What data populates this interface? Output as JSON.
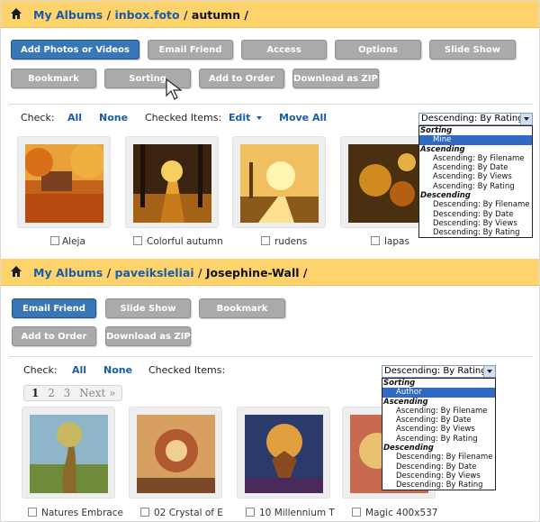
{
  "album1": {
    "breadcrumb": {
      "link1": "My Albums",
      "sep1": " / ",
      "link2": "inbox.foto",
      "sep2": " / ",
      "current": "autumn",
      "sep3": " /"
    },
    "buttons": [
      "Add Photos or Videos",
      "Email Friend",
      "Access",
      "Options",
      "Slide Show",
      "Bookmark",
      "Sorting",
      "Add to Order",
      "Download as ZIP"
    ],
    "check_label": "Check:",
    "all": "All",
    "none": "None",
    "checked_items": "Checked Items:",
    "edit": "Edit",
    "move_all": "Move All",
    "select_value": "Descending: By Rating",
    "dropdown": {
      "group_sorting": "Sorting",
      "mine": "Mine",
      "group_asc": "Ascending",
      "asc": [
        "Ascending: By Filename",
        "Ascending: By Date",
        "Ascending: By Views",
        "Ascending: By Rating"
      ],
      "group_desc": "Descending",
      "desc": [
        "Descending: By Filename",
        "Descending: By Date",
        "Descending: By Views",
        "Descending: By Rating"
      ]
    },
    "photos": [
      "Aleja",
      "Colorful autumn",
      "rudens",
      "lapas"
    ]
  },
  "album2": {
    "breadcrumb": {
      "link1": "My Albums",
      "sep1": " / ",
      "link2": "paveiksleliai",
      "sep2": " / ",
      "current": "Josephine-Wall",
      "sep3": " /"
    },
    "buttons": [
      "Email Friend",
      "Slide Show",
      "Bookmark",
      "Add to Order",
      "Download as ZIP"
    ],
    "check_label": "Check:",
    "all": "All",
    "none": "None",
    "checked_items": "Checked Items:",
    "select_value": "Descending: By Rating",
    "pager": {
      "p1": "1",
      "p2": "2",
      "p3": "3",
      "next": "Next »"
    },
    "dropdown": {
      "group_sorting": "Sorting",
      "author": "Author",
      "group_asc": "Ascending",
      "asc": [
        "Ascending: By Filename",
        "Ascending: By Date",
        "Ascending: By Views",
        "Ascending: By Rating"
      ],
      "group_desc": "Descending",
      "desc": [
        "Descending: By Filename",
        "Descending: By Date",
        "Descending: By Views",
        "Descending: By Rating"
      ]
    },
    "photos": [
      "Natures Embrace",
      "02 Crystal of E",
      "10 Millennium T",
      "Magic 400x537"
    ]
  },
  "colors": {
    "bar": "#ffd36b",
    "link": "#1a5ca8",
    "button_gray": "#a9aaac",
    "button_blue": "#3876b6",
    "highlight": "#316ac5"
  },
  "icons": [
    "home-icon",
    "edit-dropdown-icon",
    "select-arrow-icon",
    "cursor-icon"
  ]
}
